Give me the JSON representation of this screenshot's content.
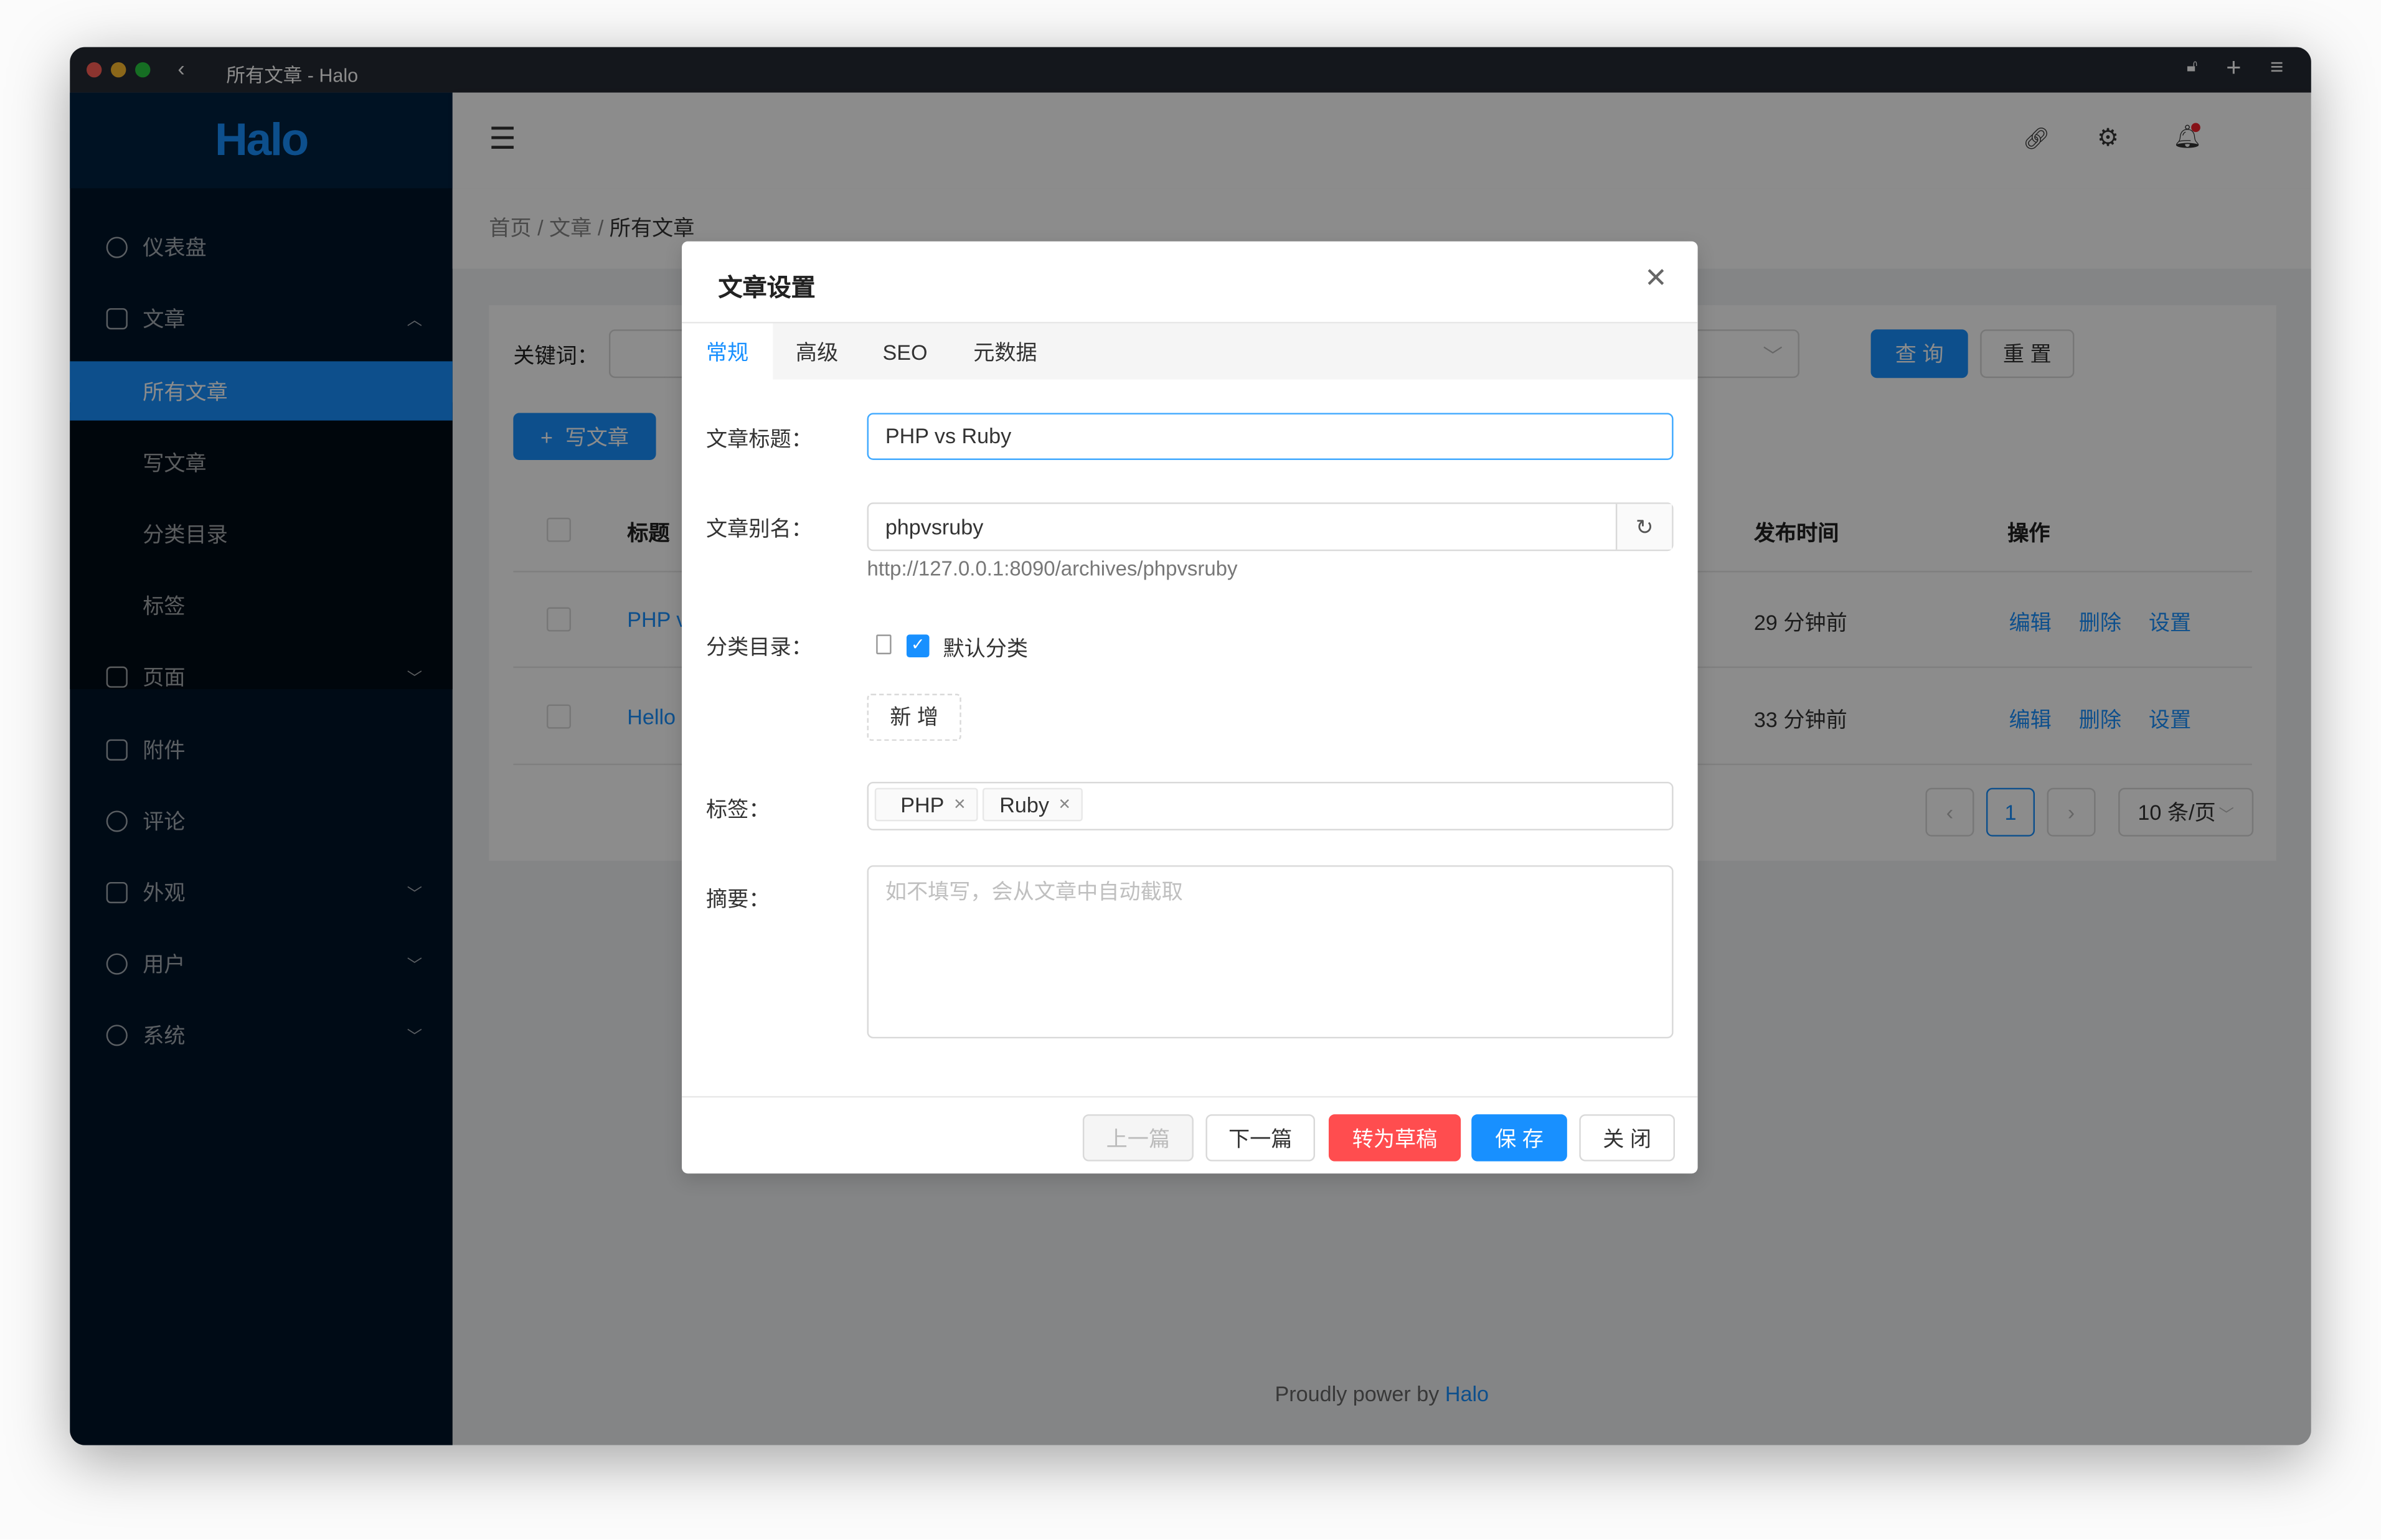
{
  "window": {
    "title": "所有文章 - Halo"
  },
  "sidebar": {
    "logo": "Halo",
    "items": [
      {
        "label": "仪表盘",
        "icon": "dashboard-icon"
      },
      {
        "label": "文章",
        "icon": "edit-icon",
        "expanded": true,
        "children": [
          {
            "label": "所有文章",
            "selected": true
          },
          {
            "label": "写文章"
          },
          {
            "label": "分类目录"
          },
          {
            "label": "标签"
          }
        ]
      },
      {
        "label": "页面",
        "icon": "book-icon"
      },
      {
        "label": "附件",
        "icon": "picture-icon"
      },
      {
        "label": "评论",
        "icon": "message-icon"
      },
      {
        "label": "外观",
        "icon": "skin-icon"
      },
      {
        "label": "用户",
        "icon": "user-icon"
      },
      {
        "label": "系统",
        "icon": "setting-icon"
      }
    ]
  },
  "breadcrumb": [
    "首页",
    "文章",
    "所有文章"
  ],
  "filter": {
    "keyword_label": "关键词：",
    "query": "查 询",
    "reset": "重 置"
  },
  "write_button": "写文章",
  "table": {
    "headers": {
      "title": "标题",
      "publish_time": "发布时间",
      "actions": "操作"
    },
    "rows": [
      {
        "title": "PHP v",
        "time": "29 分钟前"
      },
      {
        "title": "Hello",
        "time": "33 分钟前"
      }
    ],
    "actions": [
      "编辑",
      "删除",
      "设置"
    ]
  },
  "pagination": {
    "current": "1",
    "page_size": "10 条/页"
  },
  "footer": {
    "text": "Proudly power by ",
    "brand": "Halo"
  },
  "modal": {
    "title": "文章设置",
    "tabs": [
      "常规",
      "高级",
      "SEO",
      "元数据"
    ],
    "active_tab": 0,
    "fields": {
      "title_label": "文章标题：",
      "title_value": "PHP vs Ruby",
      "slug_label": "文章别名：",
      "slug_value": "phpvsruby",
      "slug_url": "http://127.0.0.1:8090/archives/phpvsruby",
      "category_label": "分类目录：",
      "category": "默认分类",
      "category_checked": true,
      "add_category": "新 增",
      "tags_label": "标签：",
      "tags": [
        "PHP",
        "Ruby"
      ],
      "summary_label": "摘要：",
      "summary_placeholder": "如不填写，会从文章中自动截取"
    },
    "buttons": {
      "prev": "上一篇",
      "next": "下一篇",
      "draft": "转为草稿",
      "save": "保 存",
      "close": "关 闭"
    }
  },
  "colors": {
    "primary": "#1890ff",
    "danger": "#ff4d4f",
    "sidebar": "#001529"
  }
}
